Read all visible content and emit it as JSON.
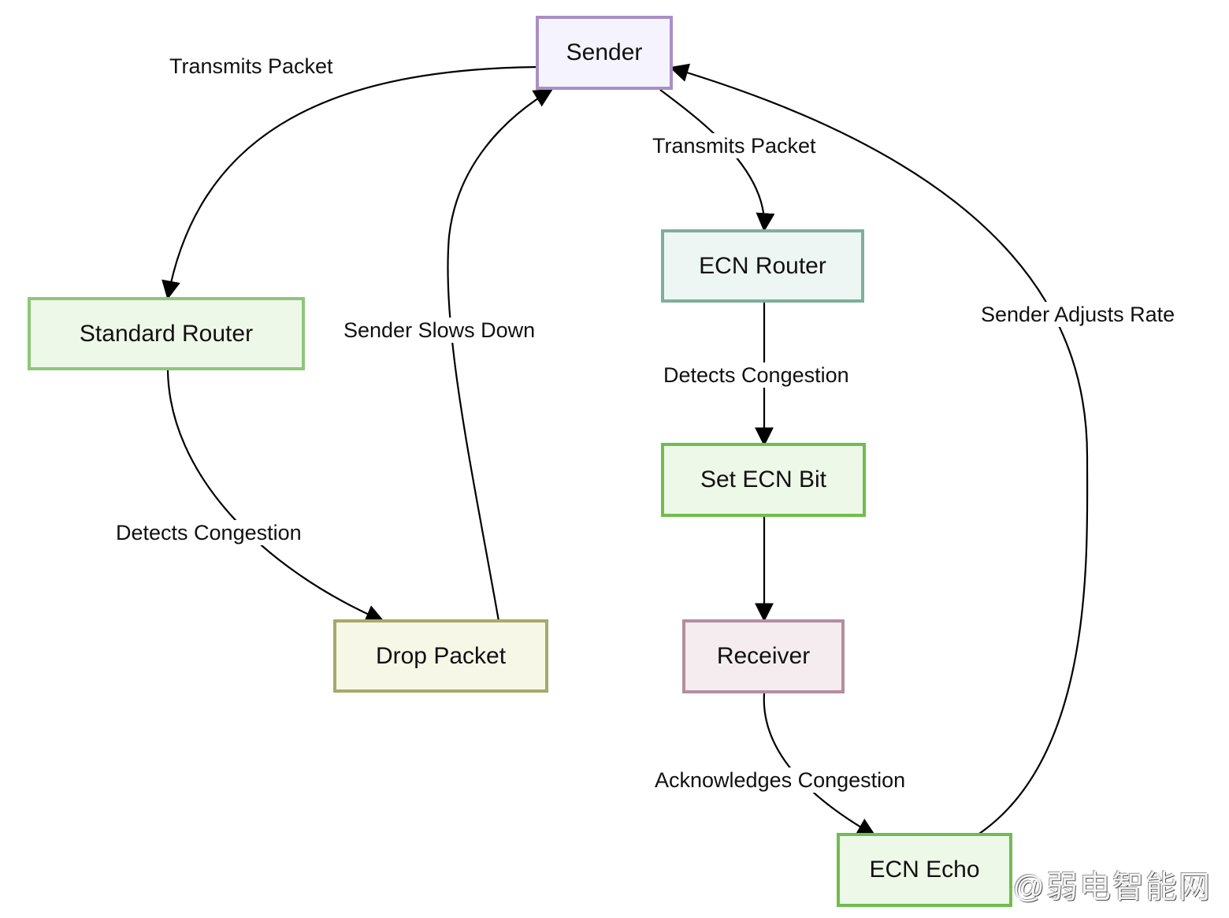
{
  "nodes": {
    "sender": {
      "label": "Sender",
      "fill": "#f5f3fd",
      "stroke": "#a98fc6"
    },
    "standard_router": {
      "label": "Standard Router",
      "fill": "#eef8e8",
      "stroke": "#8fc67a"
    },
    "ecn_router": {
      "label": "ECN Router",
      "fill": "#eef6f3",
      "stroke": "#7fae9c"
    },
    "drop_packet": {
      "label": "Drop Packet",
      "fill": "#f7f7e8",
      "stroke": "#a7aa6a"
    },
    "set_ecn_bit": {
      "label": "Set ECN Bit",
      "fill": "#eef8e8",
      "stroke": "#70bd4f"
    },
    "receiver": {
      "label": "Receiver",
      "fill": "#f5ecf0",
      "stroke": "#b38e9e"
    },
    "ecn_echo": {
      "label": "ECN Echo",
      "fill": "#eef8e8",
      "stroke": "#70bd4f"
    }
  },
  "edges": {
    "sender_to_standard": "Transmits Packet",
    "sender_to_ecn": "Transmits Packet",
    "standard_to_drop": "Detects Congestion",
    "drop_to_sender": "Sender Slows Down",
    "ecn_to_setbit": "Detects Congestion",
    "setbit_to_receiver": "",
    "receiver_to_echo": "Acknowledges Congestion",
    "echo_to_sender": "Sender Adjusts Rate"
  },
  "watermark": "@弱电智能网"
}
